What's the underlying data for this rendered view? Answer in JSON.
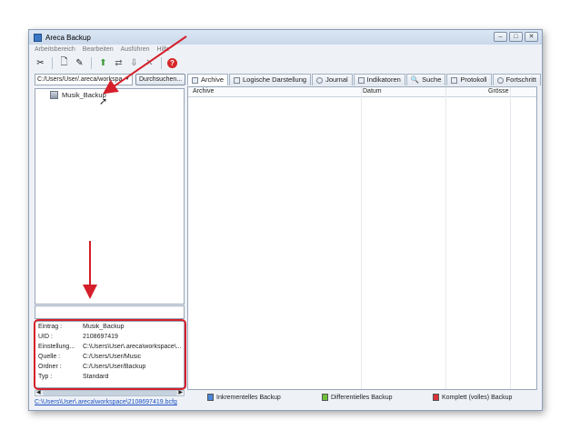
{
  "window": {
    "title": "Areca Backup"
  },
  "menu": [
    "Arbeitsbereich",
    "Bearbeiten",
    "Ausführen",
    "Hilfe"
  ],
  "path": {
    "value": "C:/Users/User/.areca/workspa",
    "browse_label": "Durchsuchen..."
  },
  "tree": {
    "item_label": "Musik_Backup"
  },
  "properties": [
    {
      "key": "Eintrag :",
      "value": "Musik_Backup"
    },
    {
      "key": "UID :",
      "value": "2108697419"
    },
    {
      "key": "Einstellung...",
      "value": "C:\\Users\\User\\.areca\\workspace\\..."
    },
    {
      "key": "Quelle :",
      "value": "C:/Users/User/Music"
    },
    {
      "key": "Ordner :",
      "value": "C:/Users/User/Backup"
    },
    {
      "key": "Typ :",
      "value": "Standard"
    }
  ],
  "config_link": "C:\\Users\\User\\.areca\\workspace\\2108697419.bcfg",
  "tabs": [
    "Archive",
    "Logische Darstellung",
    "Journal",
    "Indikatoren",
    "Suche",
    "Protokoll",
    "Fortschritt"
  ],
  "table": {
    "headers": [
      "Archive",
      "Datum",
      "Grösse"
    ]
  },
  "backup_buttons": [
    {
      "label": "Inkrementelles Backup",
      "color": "#4a86d9"
    },
    {
      "label": "Differentielles Backup",
      "color": "#6fbf3a"
    },
    {
      "label": "Komplett (volles) Backup",
      "color": "#d9343a"
    }
  ],
  "accent": {
    "annotation": "#d51f2a"
  }
}
